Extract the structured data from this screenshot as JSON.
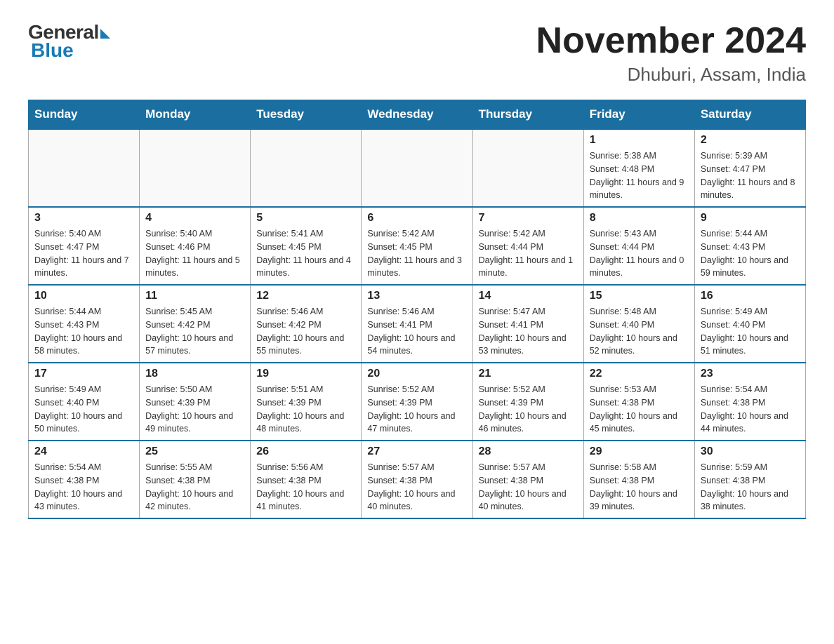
{
  "header": {
    "logo_general": "General",
    "logo_blue": "Blue",
    "title": "November 2024",
    "location": "Dhuburi, Assam, India"
  },
  "weekdays": [
    "Sunday",
    "Monday",
    "Tuesday",
    "Wednesday",
    "Thursday",
    "Friday",
    "Saturday"
  ],
  "weeks": [
    [
      {
        "day": "",
        "sunrise": "",
        "sunset": "",
        "daylight": ""
      },
      {
        "day": "",
        "sunrise": "",
        "sunset": "",
        "daylight": ""
      },
      {
        "day": "",
        "sunrise": "",
        "sunset": "",
        "daylight": ""
      },
      {
        "day": "",
        "sunrise": "",
        "sunset": "",
        "daylight": ""
      },
      {
        "day": "",
        "sunrise": "",
        "sunset": "",
        "daylight": ""
      },
      {
        "day": "1",
        "sunrise": "Sunrise: 5:38 AM",
        "sunset": "Sunset: 4:48 PM",
        "daylight": "Daylight: 11 hours and 9 minutes."
      },
      {
        "day": "2",
        "sunrise": "Sunrise: 5:39 AM",
        "sunset": "Sunset: 4:47 PM",
        "daylight": "Daylight: 11 hours and 8 minutes."
      }
    ],
    [
      {
        "day": "3",
        "sunrise": "Sunrise: 5:40 AM",
        "sunset": "Sunset: 4:47 PM",
        "daylight": "Daylight: 11 hours and 7 minutes."
      },
      {
        "day": "4",
        "sunrise": "Sunrise: 5:40 AM",
        "sunset": "Sunset: 4:46 PM",
        "daylight": "Daylight: 11 hours and 5 minutes."
      },
      {
        "day": "5",
        "sunrise": "Sunrise: 5:41 AM",
        "sunset": "Sunset: 4:45 PM",
        "daylight": "Daylight: 11 hours and 4 minutes."
      },
      {
        "day": "6",
        "sunrise": "Sunrise: 5:42 AM",
        "sunset": "Sunset: 4:45 PM",
        "daylight": "Daylight: 11 hours and 3 minutes."
      },
      {
        "day": "7",
        "sunrise": "Sunrise: 5:42 AM",
        "sunset": "Sunset: 4:44 PM",
        "daylight": "Daylight: 11 hours and 1 minute."
      },
      {
        "day": "8",
        "sunrise": "Sunrise: 5:43 AM",
        "sunset": "Sunset: 4:44 PM",
        "daylight": "Daylight: 11 hours and 0 minutes."
      },
      {
        "day": "9",
        "sunrise": "Sunrise: 5:44 AM",
        "sunset": "Sunset: 4:43 PM",
        "daylight": "Daylight: 10 hours and 59 minutes."
      }
    ],
    [
      {
        "day": "10",
        "sunrise": "Sunrise: 5:44 AM",
        "sunset": "Sunset: 4:43 PM",
        "daylight": "Daylight: 10 hours and 58 minutes."
      },
      {
        "day": "11",
        "sunrise": "Sunrise: 5:45 AM",
        "sunset": "Sunset: 4:42 PM",
        "daylight": "Daylight: 10 hours and 57 minutes."
      },
      {
        "day": "12",
        "sunrise": "Sunrise: 5:46 AM",
        "sunset": "Sunset: 4:42 PM",
        "daylight": "Daylight: 10 hours and 55 minutes."
      },
      {
        "day": "13",
        "sunrise": "Sunrise: 5:46 AM",
        "sunset": "Sunset: 4:41 PM",
        "daylight": "Daylight: 10 hours and 54 minutes."
      },
      {
        "day": "14",
        "sunrise": "Sunrise: 5:47 AM",
        "sunset": "Sunset: 4:41 PM",
        "daylight": "Daylight: 10 hours and 53 minutes."
      },
      {
        "day": "15",
        "sunrise": "Sunrise: 5:48 AM",
        "sunset": "Sunset: 4:40 PM",
        "daylight": "Daylight: 10 hours and 52 minutes."
      },
      {
        "day": "16",
        "sunrise": "Sunrise: 5:49 AM",
        "sunset": "Sunset: 4:40 PM",
        "daylight": "Daylight: 10 hours and 51 minutes."
      }
    ],
    [
      {
        "day": "17",
        "sunrise": "Sunrise: 5:49 AM",
        "sunset": "Sunset: 4:40 PM",
        "daylight": "Daylight: 10 hours and 50 minutes."
      },
      {
        "day": "18",
        "sunrise": "Sunrise: 5:50 AM",
        "sunset": "Sunset: 4:39 PM",
        "daylight": "Daylight: 10 hours and 49 minutes."
      },
      {
        "day": "19",
        "sunrise": "Sunrise: 5:51 AM",
        "sunset": "Sunset: 4:39 PM",
        "daylight": "Daylight: 10 hours and 48 minutes."
      },
      {
        "day": "20",
        "sunrise": "Sunrise: 5:52 AM",
        "sunset": "Sunset: 4:39 PM",
        "daylight": "Daylight: 10 hours and 47 minutes."
      },
      {
        "day": "21",
        "sunrise": "Sunrise: 5:52 AM",
        "sunset": "Sunset: 4:39 PM",
        "daylight": "Daylight: 10 hours and 46 minutes."
      },
      {
        "day": "22",
        "sunrise": "Sunrise: 5:53 AM",
        "sunset": "Sunset: 4:38 PM",
        "daylight": "Daylight: 10 hours and 45 minutes."
      },
      {
        "day": "23",
        "sunrise": "Sunrise: 5:54 AM",
        "sunset": "Sunset: 4:38 PM",
        "daylight": "Daylight: 10 hours and 44 minutes."
      }
    ],
    [
      {
        "day": "24",
        "sunrise": "Sunrise: 5:54 AM",
        "sunset": "Sunset: 4:38 PM",
        "daylight": "Daylight: 10 hours and 43 minutes."
      },
      {
        "day": "25",
        "sunrise": "Sunrise: 5:55 AM",
        "sunset": "Sunset: 4:38 PM",
        "daylight": "Daylight: 10 hours and 42 minutes."
      },
      {
        "day": "26",
        "sunrise": "Sunrise: 5:56 AM",
        "sunset": "Sunset: 4:38 PM",
        "daylight": "Daylight: 10 hours and 41 minutes."
      },
      {
        "day": "27",
        "sunrise": "Sunrise: 5:57 AM",
        "sunset": "Sunset: 4:38 PM",
        "daylight": "Daylight: 10 hours and 40 minutes."
      },
      {
        "day": "28",
        "sunrise": "Sunrise: 5:57 AM",
        "sunset": "Sunset: 4:38 PM",
        "daylight": "Daylight: 10 hours and 40 minutes."
      },
      {
        "day": "29",
        "sunrise": "Sunrise: 5:58 AM",
        "sunset": "Sunset: 4:38 PM",
        "daylight": "Daylight: 10 hours and 39 minutes."
      },
      {
        "day": "30",
        "sunrise": "Sunrise: 5:59 AM",
        "sunset": "Sunset: 4:38 PM",
        "daylight": "Daylight: 10 hours and 38 minutes."
      }
    ]
  ]
}
